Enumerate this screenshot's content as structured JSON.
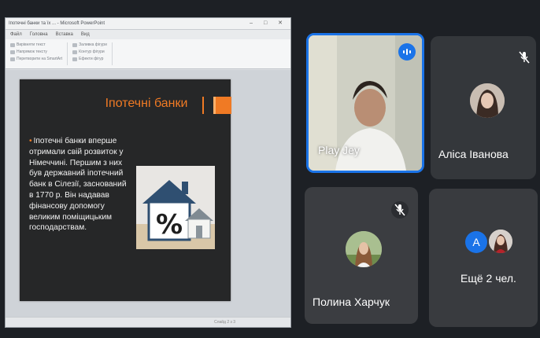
{
  "window": {
    "title": "Іпотечні банки та їх ... - Microsoft PowerPoint",
    "menu": [
      "Файл",
      "Головна",
      "Вставка",
      "Вид"
    ],
    "ribbon_groups": [
      [
        "Вирівняти текст",
        "Напрямок тексту",
        "Перетворити на SmartArt"
      ],
      [
        "Заливка фігури",
        "Контур фігури",
        "Ефекти фігур"
      ]
    ],
    "status": "Слайд 2 з 3"
  },
  "slide": {
    "title": "Іпотечні банки",
    "bullet": "Іпотечні банки вперше отримали свій розвиток у Німеччині. Першим з них був державний іпотечний банк в Сілезії, заснований в 1770 р. Він надавав фінансову допомогу великим поміщицьким господарствам.",
    "image_glyph": "%"
  },
  "participants": [
    {
      "name": "Play Jey",
      "speaking": true,
      "muted": false
    },
    {
      "name": "Аліса Іванова",
      "speaking": false,
      "muted": true
    },
    {
      "name": "Полина Харчук",
      "speaking": false,
      "muted": true
    },
    {
      "name": "Ещё 2 чел.",
      "speaking": false,
      "muted": false,
      "badge_letter": "A"
    }
  ],
  "colors": {
    "accent": "#f07a24",
    "active_speaker": "#1a73e8",
    "tile_bg": "#3a3c40",
    "page_bg": "#1d2025"
  },
  "icons": [
    "mic-off-icon",
    "speaking-indicator-icon",
    "close-icon"
  ]
}
